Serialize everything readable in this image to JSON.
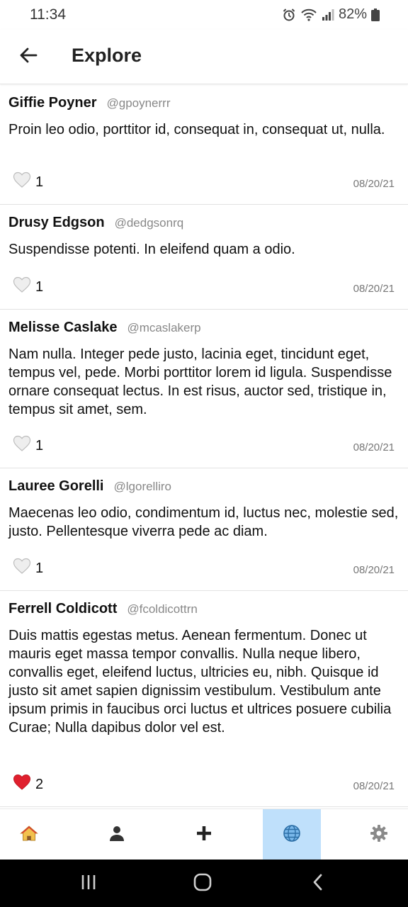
{
  "status_bar": {
    "time": "11:34",
    "battery": "82%"
  },
  "header": {
    "title": "Explore"
  },
  "posts": [
    {
      "name": "Giffie Poyner",
      "handle": "@gpoynerrr",
      "text": "Proin leo odio, porttitor id, consequat in, consequat ut, nulla.",
      "likes": "1",
      "liked": false,
      "date": "08/20/21"
    },
    {
      "name": "Drusy Edgson",
      "handle": "@dedgsonrq",
      "text": "Suspendisse potenti. In eleifend quam a odio.",
      "likes": "1",
      "liked": false,
      "date": "08/20/21"
    },
    {
      "name": "Melisse Caslake",
      "handle": "@mcaslakerp",
      "text": "Nam nulla. Integer pede justo, lacinia eget, tincidunt eget, tempus vel, pede. Morbi porttitor lorem id ligula. Suspendisse ornare consequat lectus. In est risus, auctor sed, tristique in, tempus sit amet, sem.",
      "likes": "1",
      "liked": false,
      "date": "08/20/21"
    },
    {
      "name": "Lauree Gorelli",
      "handle": "@lgorelliro",
      "text": "Maecenas leo odio, condimentum id, luctus nec, molestie sed, justo. Pellentesque viverra pede ac diam.",
      "likes": "1",
      "liked": false,
      "date": "08/20/21"
    },
    {
      "name": "Ferrell Coldicott",
      "handle": "@fcoldicottrn",
      "text": "Duis mattis egestas metus. Aenean fermentum. Donec ut mauris eget massa tempor convallis. Nulla neque libero, convallis eget, eleifend luctus, ultricies eu, nibh. Quisque id justo sit amet sapien dignissim vestibulum. Vestibulum ante ipsum primis in faucibus orci luctus et ultrices posuere cubilia Curae; Nulla dapibus dolor vel est.",
      "likes": "2",
      "liked": true,
      "date": "08/20/21"
    }
  ],
  "bottom_nav": [
    {
      "icon": "home-icon",
      "active": false
    },
    {
      "icon": "profile-icon",
      "active": false
    },
    {
      "icon": "add-icon",
      "active": false
    },
    {
      "icon": "globe-icon",
      "active": true
    },
    {
      "icon": "settings-gear-icon",
      "active": false
    }
  ],
  "colors": {
    "accent_active_tab": "#bfe0fb",
    "heart_liked": "#e0202e",
    "heart_unliked": "#eeeeee"
  }
}
